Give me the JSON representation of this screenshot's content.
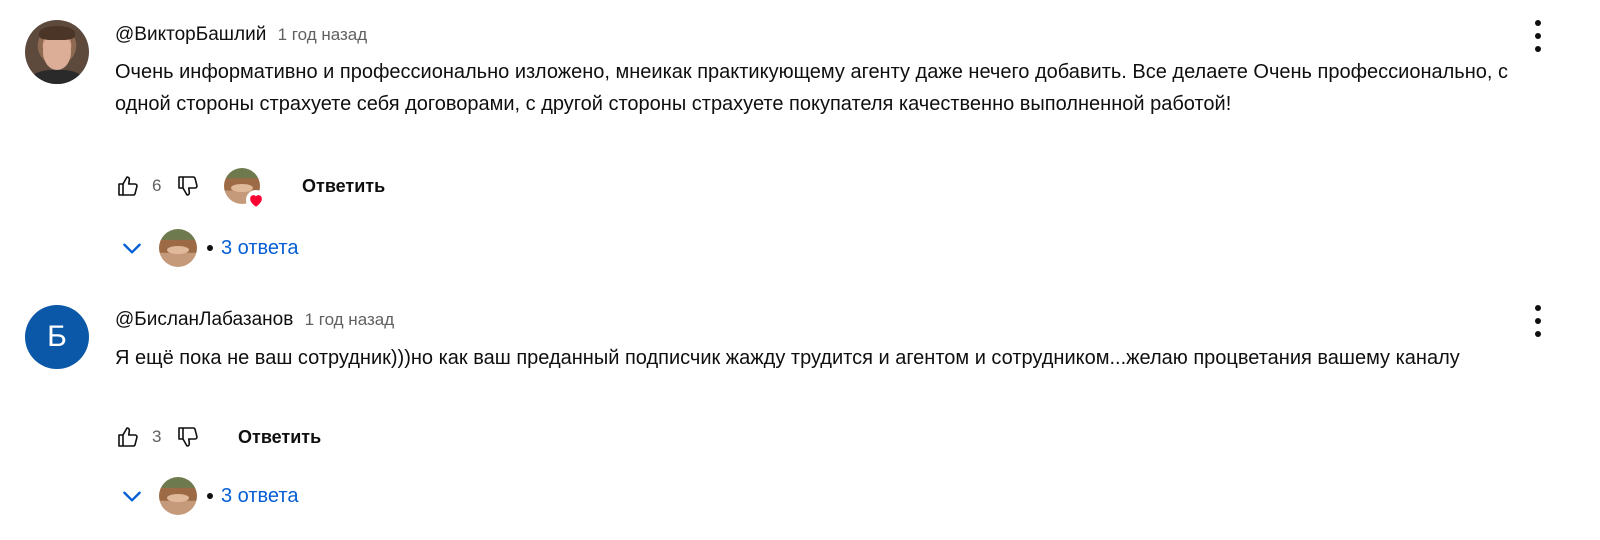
{
  "comments": [
    {
      "author": "@ВикторБашлий",
      "time": "1 год назад",
      "text": "Очень информативно и профессионально изложено, мнеикак практикующему агенту даже нечего добавить. Все делаете Очень профессионально, с одной стороны страхуете себя договорами, с другой стороны страхуете покупателя качественно выполненной работой!",
      "likes": "6",
      "reply_label": "Ответить",
      "replies_label": "3 ответа",
      "creator_heart": true
    },
    {
      "author": "@БисланЛабазанов",
      "time": "1 год назад",
      "avatar_letter": "Б",
      "avatar_color": "#0b57a8",
      "text": "Я ещё пока не ваш сотрудник)))но как ваш преданный подписчик жажду трудится и агентом и сотрудником...желаю процветания вашему каналу",
      "likes": "3",
      "reply_label": "Ответить",
      "replies_label": "3 ответа",
      "creator_heart": false
    }
  ],
  "colors": {
    "link": "#065fd4",
    "heart": "#ff0033",
    "secondary_text": "#606060"
  },
  "icons": [
    "like-icon",
    "dislike-icon",
    "chevron-down-icon",
    "more-vert-icon",
    "heart-icon"
  ]
}
